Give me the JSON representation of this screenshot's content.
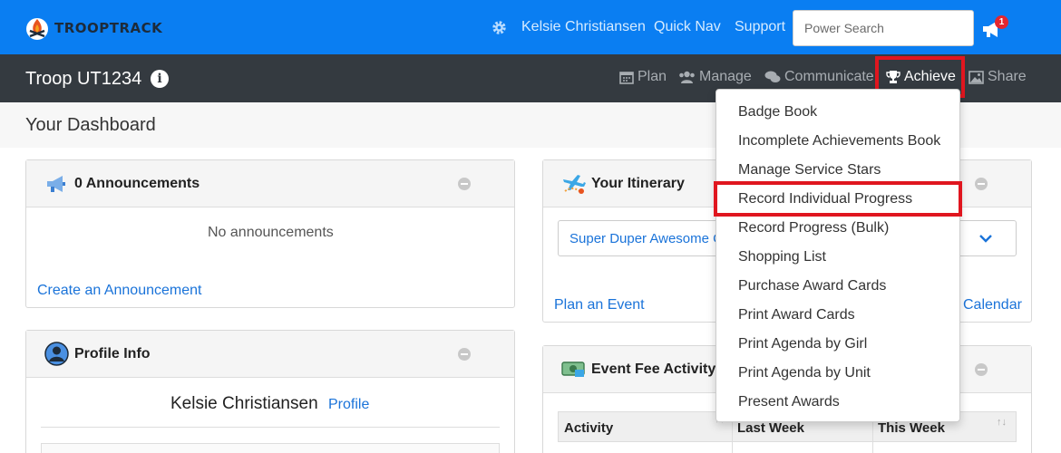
{
  "app": {
    "logo_text": "TROOPTRACK"
  },
  "top_nav": {
    "user_name": "Kelsie Christiansen",
    "quick_nav": "Quick Nav",
    "support": "Support",
    "search_placeholder": "Power Search",
    "notification_count": "1"
  },
  "sub_nav": {
    "troop_name": "Troop UT1234",
    "info_glyph": "i",
    "items": [
      {
        "label": "Plan",
        "icon": "calendar-icon"
      },
      {
        "label": "Manage",
        "icon": "users-icon"
      },
      {
        "label": "Communicate",
        "icon": "comments-icon"
      },
      {
        "label": "Achieve",
        "icon": "trophy-icon"
      },
      {
        "label": "Share",
        "icon": "image-icon"
      }
    ]
  },
  "dashboard": {
    "title": "Your Dashboard",
    "announcements": {
      "title": "0 Announcements",
      "empty_text": "No announcements",
      "create_link": "Create an Announcement"
    },
    "profile": {
      "title": "Profile Info",
      "name": "Kelsie Christiansen",
      "profile_link": "Profile"
    },
    "itinerary": {
      "title": "Your Itinerary",
      "selected_event": "Super Duper Awesome C",
      "plan_link": "Plan an Event",
      "calendar_link": "Calendar"
    },
    "event_fees": {
      "title": "Event Fee Activity",
      "columns": [
        "Activity",
        "Last Week",
        "This Week"
      ]
    }
  },
  "achieve_menu": {
    "items": [
      "Badge Book",
      "Incomplete Achievements Book",
      "Manage Service Stars",
      "Record Individual Progress",
      "Record Progress (Bulk)",
      "Shopping List",
      "Purchase Award Cards",
      "Print Award Cards",
      "Print Agenda by Girl",
      "Print Agenda by Unit",
      "Present Awards"
    ]
  },
  "colors": {
    "topbar": "#0a7ef2",
    "subbar": "#343a40",
    "highlight": "#e0161f",
    "link": "#1a73d9"
  }
}
